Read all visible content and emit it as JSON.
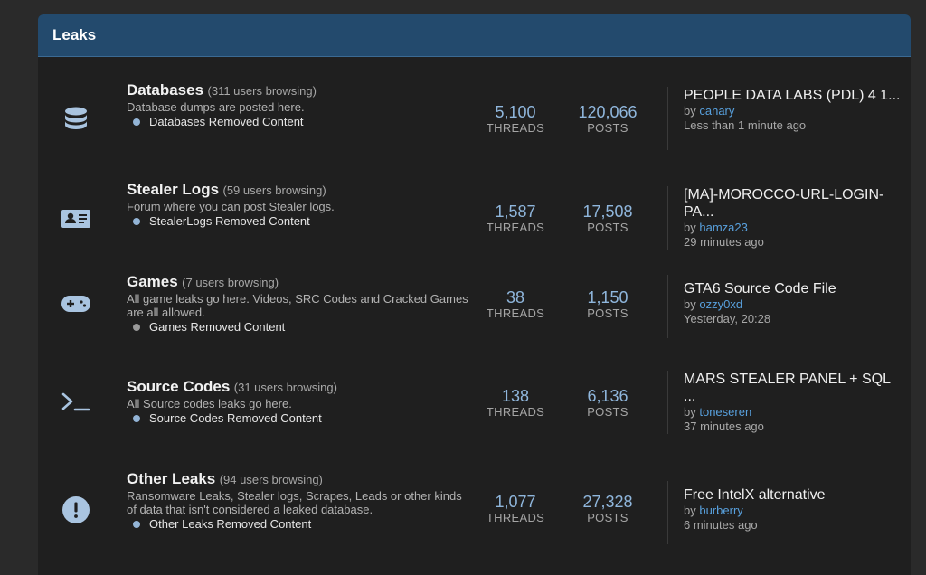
{
  "section": {
    "title": "Leaks"
  },
  "labels": {
    "threads": "THREADS",
    "posts": "POSTS",
    "by": "by"
  },
  "colors": {
    "header_bg": "#234a6d",
    "icon": "#a9c4e0",
    "number": "#8fb6dc",
    "username": "#58a0dd",
    "panel_bg": "#1f1f1f"
  },
  "forums": [
    {
      "icon": "database-icon",
      "name": "Databases",
      "browsing": "(311 users browsing)",
      "description": "Database dumps are posted here.",
      "subforum": "Databases Removed Content",
      "threads": "5,100",
      "posts": "120,066",
      "last_title": "PEOPLE DATA LABS (PDL) 4 1...",
      "last_user": "canary",
      "last_time": "Less than 1 minute ago"
    },
    {
      "icon": "id-card-icon",
      "name": "Stealer Logs",
      "browsing": "(59 users browsing)",
      "description": "Forum where you can post Stealer logs.",
      "subforum": "StealerLogs Removed Content",
      "threads": "1,587",
      "posts": "17,508",
      "last_title": "[MA]-MOROCCO-URL-LOGIN-PA...",
      "last_user": "hamza23",
      "last_time": "29 minutes ago"
    },
    {
      "icon": "gamepad-icon",
      "name": "Games",
      "browsing": "(7 users browsing)",
      "description": "All game leaks go here. Videos, SRC Codes and Cracked Games are all allowed.",
      "subforum": "Games Removed Content",
      "threads": "38",
      "posts": "1,150",
      "last_title": "GTA6 Source Code File",
      "last_user": "ozzy0xd",
      "last_time": "Yesterday, 20:28"
    },
    {
      "icon": "terminal-icon",
      "name": "Source Codes",
      "browsing": "(31 users browsing)",
      "description": "All Source codes leaks go here.",
      "subforum": "Source Codes Removed Content",
      "threads": "138",
      "posts": "6,136",
      "last_title": "MARS STEALER PANEL + SQL ...",
      "last_user": "toneseren",
      "last_time": "37 minutes ago"
    },
    {
      "icon": "exclamation-icon",
      "name": "Other Leaks",
      "browsing": "(94 users browsing)",
      "description": "Ransomware Leaks, Stealer logs, Scrapes, Leads or other kinds of data that isn't considered a leaked database.",
      "subforum": "Other Leaks Removed Content",
      "threads": "1,077",
      "posts": "27,328",
      "last_title": "Free IntelX alternative",
      "last_user": "burberry",
      "last_time": "6 minutes ago"
    }
  ]
}
